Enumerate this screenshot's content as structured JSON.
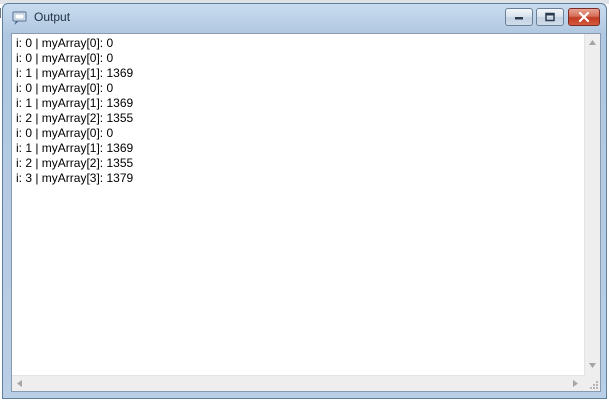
{
  "window": {
    "title": "Output"
  },
  "output": {
    "lines": [
      "i: 0 | myArray[0]: 0",
      "i: 0 | myArray[0]: 0",
      "i: 1 | myArray[1]: 1369",
      "i: 0 | myArray[0]: 0",
      "i: 1 | myArray[1]: 1369",
      "i: 2 | myArray[2]: 1355",
      "i: 0 | myArray[0]: 0",
      "i: 1 | myArray[1]: 1369",
      "i: 2 | myArray[2]: 1355",
      "i: 3 | myArray[3]: 1379"
    ]
  },
  "icons": {
    "app": "output-window-icon",
    "minimize": "minimize-icon",
    "maximize": "maximize-icon",
    "close": "close-icon",
    "scroll_up": "scroll-up-arrow-icon",
    "scroll_down": "scroll-down-arrow-icon",
    "scroll_left": "scroll-left-arrow-icon",
    "scroll_right": "scroll-right-arrow-icon",
    "resize_grip": "resize-grip-icon"
  },
  "colors": {
    "frame": "#b9cfe6",
    "close_button": "#c9442b",
    "text": "#000000"
  }
}
